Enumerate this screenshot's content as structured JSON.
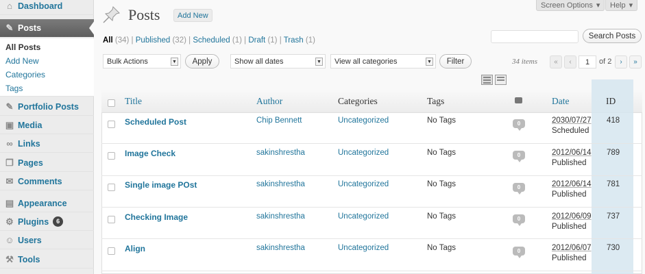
{
  "sidebar": {
    "items": [
      {
        "label": "Dashboard",
        "icon": "dashboard-icon"
      },
      {
        "label": "Posts",
        "icon": "pushpin-icon"
      },
      {
        "label": "Portfolio Posts",
        "icon": "pushpin-icon"
      },
      {
        "label": "Media",
        "icon": "media-icon"
      },
      {
        "label": "Links",
        "icon": "links-icon"
      },
      {
        "label": "Pages",
        "icon": "pages-icon"
      },
      {
        "label": "Comments",
        "icon": "comments-icon"
      },
      {
        "label": "Appearance",
        "icon": "appearance-icon"
      },
      {
        "label": "Plugins",
        "icon": "plugins-icon",
        "badge": "6"
      },
      {
        "label": "Users",
        "icon": "users-icon"
      },
      {
        "label": "Tools",
        "icon": "tools-icon"
      }
    ],
    "submenu": [
      "All Posts",
      "Add New",
      "Categories",
      "Tags"
    ]
  },
  "top": {
    "screen_options": "Screen Options",
    "help": "Help"
  },
  "header": {
    "title": "Posts",
    "add_new": "Add New"
  },
  "filters": [
    {
      "label": "All",
      "count": "(34)"
    },
    {
      "label": "Published",
      "count": "(32)"
    },
    {
      "label": "Scheduled",
      "count": "(1)"
    },
    {
      "label": "Draft",
      "count": "(1)"
    },
    {
      "label": "Trash",
      "count": "(1)"
    }
  ],
  "search": {
    "button": "Search Posts",
    "value": ""
  },
  "toolbar": {
    "bulk_actions": "Bulk Actions",
    "apply": "Apply",
    "dates": "Show all dates",
    "categories": "View all categories",
    "filter": "Filter"
  },
  "pagination": {
    "items": "34 items",
    "current": "1",
    "of": "of 2",
    "first": "«",
    "prev": "‹",
    "next": "›",
    "last": "»"
  },
  "table": {
    "headers": {
      "title": "Title",
      "author": "Author",
      "categories": "Categories",
      "tags": "Tags",
      "date": "Date",
      "id": "ID"
    },
    "rows": [
      {
        "title": "Scheduled Post",
        "author": "Chip Bennett",
        "category": "Uncategorized",
        "tags": "No Tags",
        "comments": "0",
        "date": "2030/07/27",
        "status": "Scheduled",
        "id": "418"
      },
      {
        "title": "Image Check",
        "author": "sakinshrestha",
        "category": "Uncategorized",
        "tags": "No Tags",
        "comments": "0",
        "date": "2012/06/14",
        "status": "Published",
        "id": "789"
      },
      {
        "title": "Single image POst",
        "author": "sakinshrestha",
        "category": "Uncategorized",
        "tags": "No Tags",
        "comments": "0",
        "date": "2012/06/14",
        "status": "Published",
        "id": "781"
      },
      {
        "title": "Checking Image",
        "author": "sakinshrestha",
        "category": "Uncategorized",
        "tags": "No Tags",
        "comments": "0",
        "date": "2012/06/09",
        "status": "Published",
        "id": "737"
      },
      {
        "title": "Align",
        "author": "sakinshrestha",
        "category": "Uncategorized",
        "tags": "No Tags",
        "comments": "0",
        "date": "2012/06/07",
        "status": "Published",
        "id": "730"
      }
    ]
  }
}
